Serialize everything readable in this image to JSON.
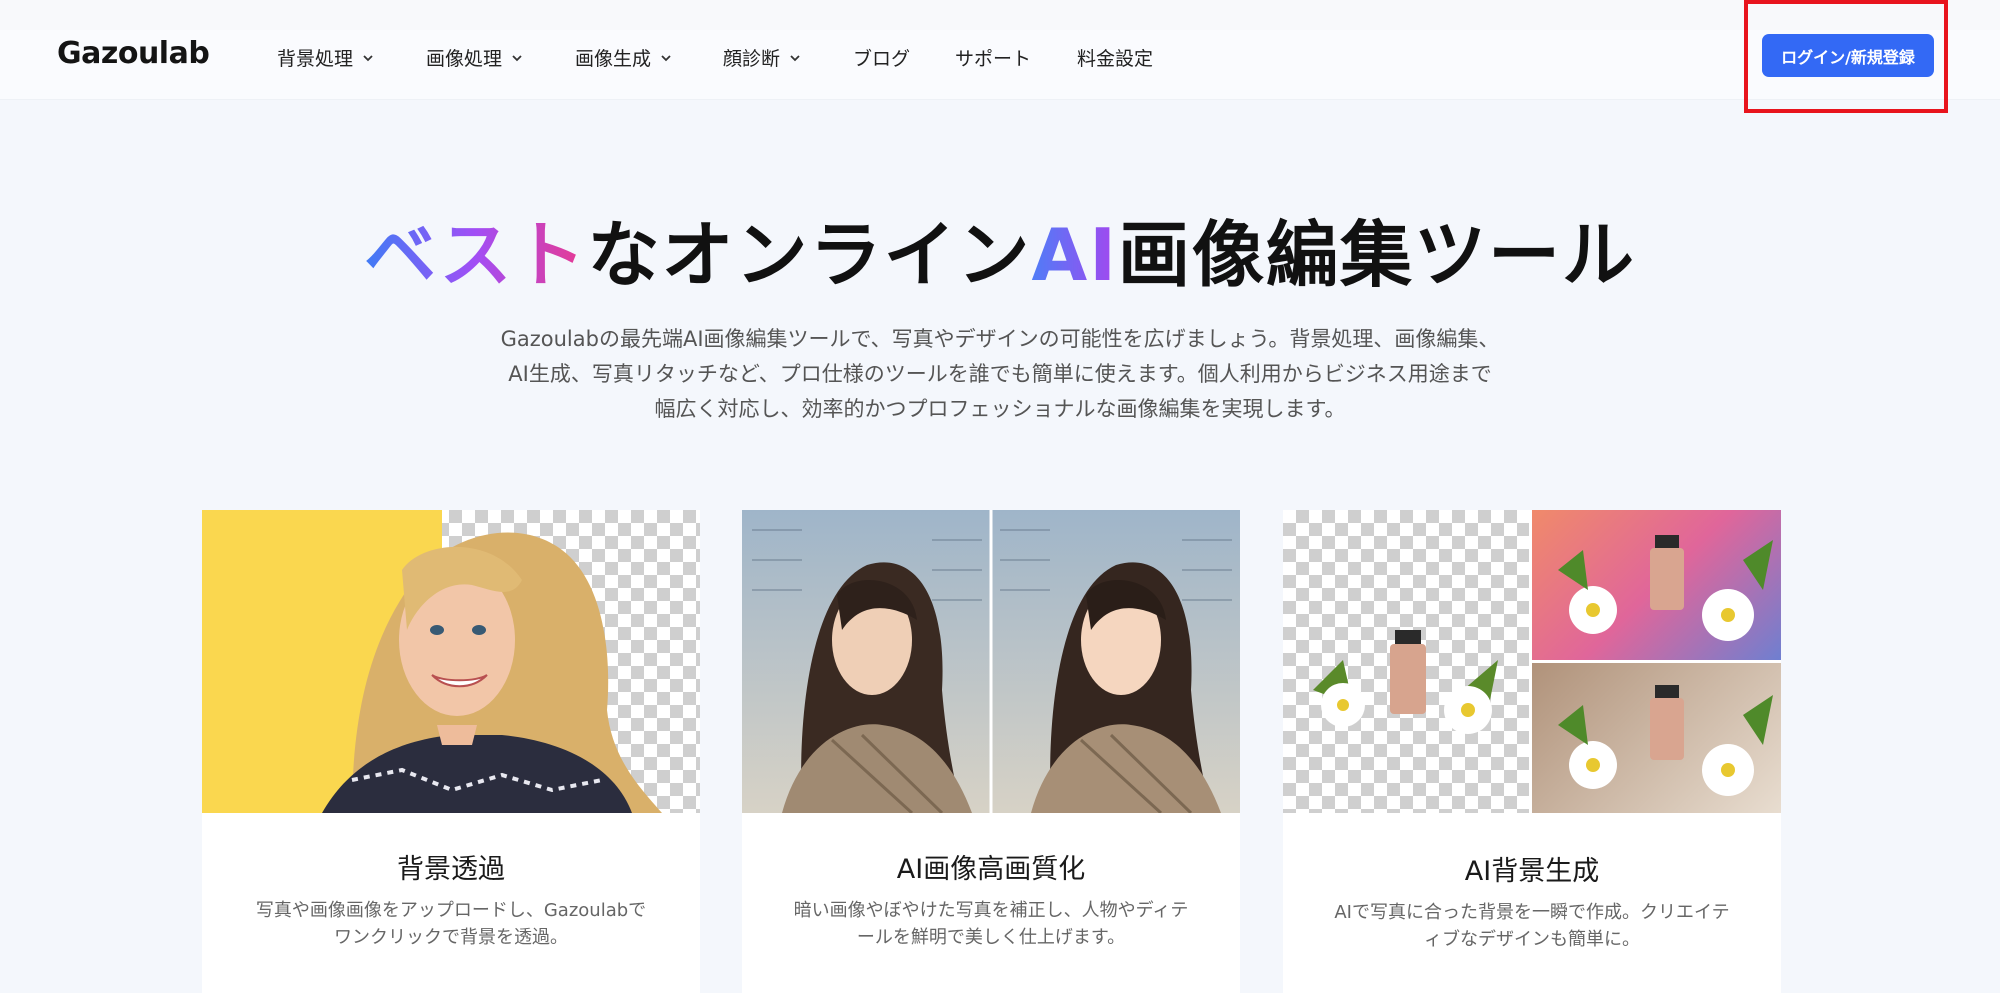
{
  "header": {
    "logo": "Gazoulab",
    "nav": [
      {
        "label": "背景処理",
        "has_dropdown": true
      },
      {
        "label": "画像処理",
        "has_dropdown": true
      },
      {
        "label": "画像生成",
        "has_dropdown": true
      },
      {
        "label": "顔診断",
        "has_dropdown": true
      },
      {
        "label": "ブログ",
        "has_dropdown": false
      },
      {
        "label": "サポート",
        "has_dropdown": false
      },
      {
        "label": "料金設定",
        "has_dropdown": false
      }
    ],
    "login_label": "ログイン/新規登録"
  },
  "hero": {
    "title_part1": "ベスト",
    "title_part2": "なオンライン",
    "title_part3": "AI",
    "title_part4": "画像編集ツール",
    "description_lines": [
      "Gazoulabの最先端AI画像編集ツールで、写真やデザインの可能性を広げましょう。背景処理、画像編集、",
      "AI生成、写真リタッチなど、プロ仕様のツールを誰でも簡単に使えます。個人利用からビジネス用途まで",
      "幅広く対応し、効率的かつプロフェッショナルな画像編集を実現します。"
    ]
  },
  "cards": [
    {
      "title": "背景透過",
      "desc_lines": [
        "写真や画像画像をアップロードし、Gazoulabで",
        "ワンクリックで背景を透過。"
      ]
    },
    {
      "title": "AI画像高画質化",
      "desc_lines": [
        "暗い画像やぼやけた写真を補正し、人物やディテ",
        "ールを鮮明で美しく仕上げます。"
      ]
    },
    {
      "title": "AI背景生成",
      "desc_lines": [
        "AIで写真に合った背景を一瞬で作成。クリエイテ",
        "ィブなデザインも簡単に。"
      ]
    }
  ],
  "colors": {
    "accent": "#3369f5",
    "highlight": "#e8141d",
    "background": "#f4f7fc"
  }
}
